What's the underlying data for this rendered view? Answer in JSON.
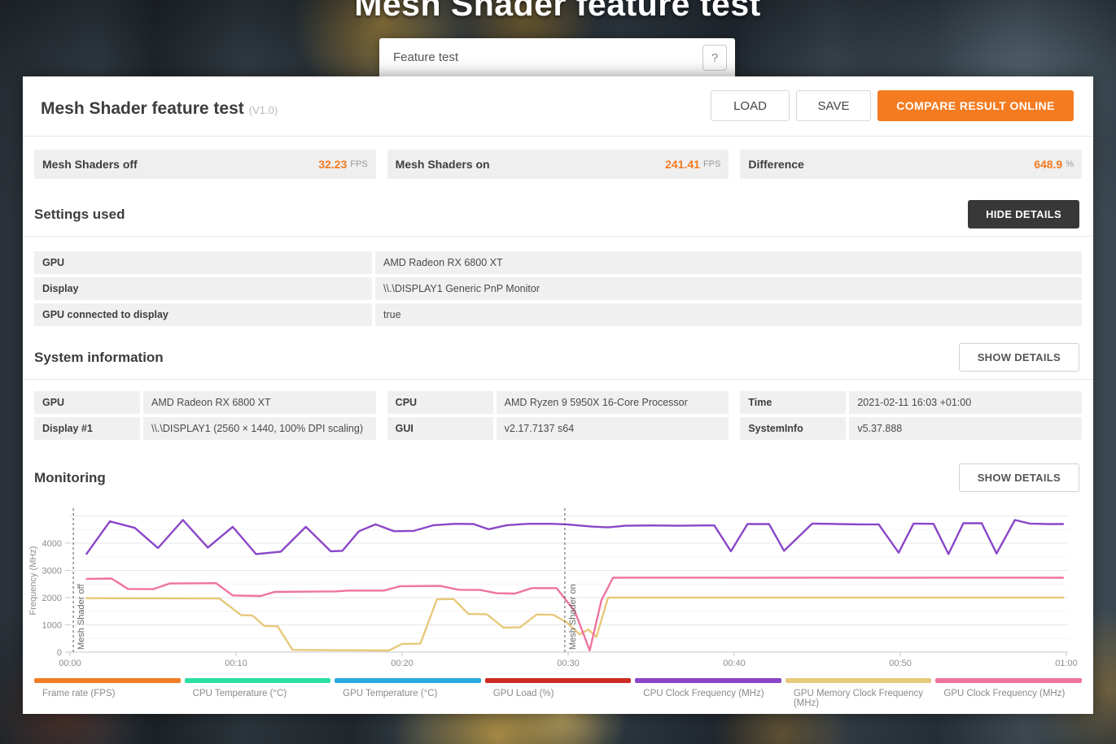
{
  "page": {
    "hero_title": "Mesh Shader feature test",
    "selector": {
      "label": "Feature test",
      "help_label": "?"
    }
  },
  "header": {
    "title": "Mesh Shader feature test",
    "version": "(V1.0)",
    "buttons": {
      "load": "LOAD",
      "save": "SAVE",
      "compare": "COMPARE RESULT ONLINE"
    },
    "accent_color": "#f47b20"
  },
  "results": [
    {
      "label": "Mesh Shaders off",
      "value": "32.23",
      "unit": "FPS"
    },
    {
      "label": "Mesh Shaders on",
      "value": "241.41",
      "unit": "FPS"
    },
    {
      "label": "Difference",
      "value": "648.9",
      "unit": "%"
    }
  ],
  "settings": {
    "heading": "Settings used",
    "toggle": "HIDE DETAILS",
    "rows": [
      {
        "label": "GPU",
        "value": "AMD Radeon RX 6800 XT"
      },
      {
        "label": "Display",
        "value": "\\\\.\\DISPLAY1 Generic PnP Monitor"
      },
      {
        "label": "GPU connected to display",
        "value": "true"
      }
    ]
  },
  "system": {
    "heading": "System information",
    "toggle": "SHOW DETAILS",
    "columns": [
      {
        "cells": [
          {
            "label": "GPU",
            "value": "AMD Radeon RX 6800 XT"
          },
          {
            "label": "Display #1",
            "value": "\\\\.\\DISPLAY1 (2560 × 1440, 100% DPI scaling)"
          }
        ]
      },
      {
        "cells": [
          {
            "label": "CPU",
            "value": "AMD Ryzen 9 5950X 16-Core Processor"
          },
          {
            "label": "GUI",
            "value": "v2.17.7137 s64"
          }
        ]
      },
      {
        "cells": [
          {
            "label": "Time",
            "value": "2021-02-11 16:03 +01:00"
          },
          {
            "label": "SystemInfo",
            "value": "v5.37.888"
          }
        ]
      }
    ]
  },
  "monitoring": {
    "heading": "Monitoring",
    "toggle": "SHOW DETAILS"
  },
  "chart_data": {
    "type": "line",
    "ylabel": "Frequency (MHz)",
    "ylim": [
      0,
      5300
    ],
    "y_ticks": [
      0,
      1000,
      2000,
      3000,
      4000
    ],
    "x_ticks": [
      "00:00",
      "00:10",
      "00:20",
      "00:30",
      "00:40",
      "00:50",
      "01:00"
    ],
    "x_range_seconds": [
      0,
      60
    ],
    "grid": "horizontal minor lines every 500 MHz",
    "legend_position": "bottom",
    "markers": [
      {
        "time_seconds": 0.2,
        "label": "Mesh Shader off"
      },
      {
        "time_seconds": 29.8,
        "label": "Mesh Shader on"
      }
    ],
    "legend": [
      {
        "label": "Frame rate (FPS)",
        "color": "#f07d25",
        "plotted": false
      },
      {
        "label": "CPU Temperature (°C)",
        "color": "#2bdfa2",
        "plotted": false
      },
      {
        "label": "GPU Temperature (°C)",
        "color": "#2ca9e1",
        "plotted": false
      },
      {
        "label": "GPU Load (%)",
        "color": "#cb2c24",
        "plotted": false
      },
      {
        "label": "CPU Clock Frequency (MHz)",
        "color": "#8a46c8",
        "plotted": true
      },
      {
        "label": "GPU Memory Clock Frequency (MHz)",
        "color": "#e7c97b",
        "plotted": true
      },
      {
        "label": "GPU Clock Frequency (MHz)",
        "color": "#ef739f",
        "plotted": true
      }
    ],
    "series": [
      {
        "name": "GPU Memory Clock Frequency (MHz)",
        "color": "#e7c97b",
        "points": [
          [
            1,
            1980
          ],
          [
            9,
            1970
          ],
          [
            10.3,
            1360
          ],
          [
            11,
            1340
          ],
          [
            11.7,
            960
          ],
          [
            12.5,
            950
          ],
          [
            13.4,
            80
          ],
          [
            19.2,
            60
          ],
          [
            20,
            300
          ],
          [
            21.1,
            310
          ],
          [
            22.1,
            1940
          ],
          [
            23.1,
            1950
          ],
          [
            24,
            1400
          ],
          [
            25.1,
            1390
          ],
          [
            26.1,
            900
          ],
          [
            27.1,
            910
          ],
          [
            28.1,
            1380
          ],
          [
            29.1,
            1370
          ],
          [
            29.9,
            1100
          ],
          [
            30.7,
            650
          ],
          [
            31.2,
            830
          ],
          [
            31.7,
            560
          ],
          [
            32.4,
            2000
          ],
          [
            40,
            2000
          ],
          [
            48,
            2000
          ],
          [
            56,
            2000
          ],
          [
            59.8,
            2000
          ]
        ]
      },
      {
        "name": "GPU Clock Frequency (MHz)",
        "color": "#ef739f",
        "points": [
          [
            1,
            2690
          ],
          [
            2.5,
            2700
          ],
          [
            3.5,
            2320
          ],
          [
            5,
            2310
          ],
          [
            6,
            2520
          ],
          [
            8.8,
            2530
          ],
          [
            9.8,
            2080
          ],
          [
            11.5,
            2060
          ],
          [
            12.3,
            2210
          ],
          [
            16,
            2230
          ],
          [
            16.8,
            2260
          ],
          [
            18.9,
            2260
          ],
          [
            19.9,
            2420
          ],
          [
            22.3,
            2430
          ],
          [
            23.4,
            2290
          ],
          [
            24.7,
            2280
          ],
          [
            25.7,
            2160
          ],
          [
            26.8,
            2150
          ],
          [
            27.8,
            2350
          ],
          [
            29.3,
            2350
          ],
          [
            30.4,
            1500
          ],
          [
            31.3,
            60
          ],
          [
            32,
            1900
          ],
          [
            32.7,
            2730
          ],
          [
            36,
            2735
          ],
          [
            40,
            2730
          ],
          [
            45,
            2735
          ],
          [
            50,
            2730
          ],
          [
            55,
            2735
          ],
          [
            59.8,
            2730
          ]
        ]
      },
      {
        "name": "CPU Clock Frequency (MHz)",
        "color": "#8a46c8",
        "points": [
          [
            1,
            3610
          ],
          [
            2.4,
            4800
          ],
          [
            3.9,
            4560
          ],
          [
            5.3,
            3820
          ],
          [
            6.8,
            4850
          ],
          [
            8.3,
            3840
          ],
          [
            9.8,
            4600
          ],
          [
            11.2,
            3600
          ],
          [
            12.7,
            3690
          ],
          [
            14.2,
            4600
          ],
          [
            15.7,
            3700
          ],
          [
            16.4,
            3720
          ],
          [
            17.4,
            4440
          ],
          [
            18.4,
            4690
          ],
          [
            19.5,
            4440
          ],
          [
            20.7,
            4450
          ],
          [
            21.9,
            4660
          ],
          [
            23.2,
            4710
          ],
          [
            24.3,
            4700
          ],
          [
            25.2,
            4510
          ],
          [
            26.3,
            4660
          ],
          [
            27.6,
            4710
          ],
          [
            29,
            4710
          ],
          [
            29.9,
            4690
          ],
          [
            31.4,
            4610
          ],
          [
            32.4,
            4580
          ],
          [
            33.4,
            4640
          ],
          [
            35,
            4650
          ],
          [
            36.6,
            4640
          ],
          [
            38.2,
            4650
          ],
          [
            38.8,
            4650
          ],
          [
            39.8,
            3700
          ],
          [
            40.8,
            4700
          ],
          [
            42.1,
            4700
          ],
          [
            43,
            3720
          ],
          [
            44.7,
            4720
          ],
          [
            46.3,
            4700
          ],
          [
            47.6,
            4690
          ],
          [
            48.7,
            4690
          ],
          [
            49.9,
            3650
          ],
          [
            50.8,
            4720
          ],
          [
            52,
            4710
          ],
          [
            52.9,
            3600
          ],
          [
            53.8,
            4730
          ],
          [
            54.9,
            4730
          ],
          [
            55.8,
            3620
          ],
          [
            56.9,
            4850
          ],
          [
            57.8,
            4720
          ],
          [
            58.9,
            4700
          ],
          [
            59.8,
            4700
          ]
        ]
      }
    ]
  }
}
